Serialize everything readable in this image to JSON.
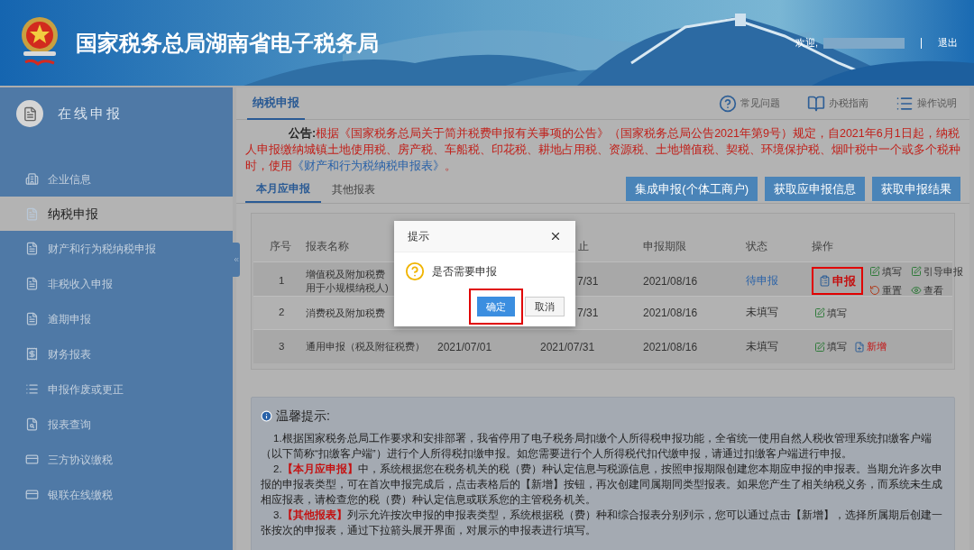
{
  "header": {
    "title": "国家税务总局湖南省电子税务局",
    "welcome": "欢迎,",
    "logout": "退出"
  },
  "sidebar": {
    "title": "在线申报",
    "items": [
      {
        "label": "企业信息",
        "selected": false
      },
      {
        "label": "纳税申报",
        "selected": true
      },
      {
        "label": "财产和行为税纳税申报",
        "selected": false
      },
      {
        "label": "非税收入申报",
        "selected": false
      },
      {
        "label": "逾期申报",
        "selected": false
      },
      {
        "label": "财务报表",
        "selected": false
      },
      {
        "label": "申报作废或更正",
        "selected": false
      },
      {
        "label": "报表查询",
        "selected": false
      },
      {
        "label": "三方协议缴税",
        "selected": false
      },
      {
        "label": "银联在线缴税",
        "selected": false
      }
    ]
  },
  "page_tabs": [
    {
      "label": "纳税申报",
      "selected": true
    }
  ],
  "help_links": [
    "常见问题",
    "办税指南",
    "操作说明"
  ],
  "notice": {
    "label": "公告:",
    "text": "根据《国家税务总局关于简并税费申报有关事项的公告》（国家税务总局公告2021年第9号）规定，自2021年6月1日起，纳税人申报缴纳城镇土地使用税、房产税、车船税、印花税、耕地占用税、资源税、土地增值税、契税、环境保护税、烟叶税中一个或多个税种时，使用",
    "link": "《财产和行为税纳税申报表》",
    "end": "。"
  },
  "sub_tabs": [
    {
      "label": "本月应申报",
      "selected": true
    },
    {
      "label": "其他报表",
      "selected": false
    }
  ],
  "toolbar_buttons": [
    "集成申报(个体工商户)",
    "获取应申报信息",
    "获取申报结果"
  ],
  "table": {
    "columns": [
      "序号",
      "报表名称",
      "止",
      "申报期限",
      "状态",
      "操作"
    ],
    "rows": [
      {
        "no": "1",
        "name": [
          "增值税及附加税费",
          "用于小规模纳税人)"
        ],
        "end": "7/31",
        "deadline": "2021/08/16",
        "status": "待申报",
        "color": "#2a62a8",
        "actions": [
          {
            "label": "申报",
            "kind": "declare",
            "highlighted": true
          },
          {
            "label": "填写",
            "kind": "edit",
            "highlighted": false
          },
          {
            "label": "引导申报",
            "kind": "edit",
            "highlighted": false
          },
          {
            "label": "重置",
            "kind": "reset",
            "highlighted": false
          },
          {
            "label": "查看",
            "kind": "view",
            "highlighted": false
          }
        ]
      },
      {
        "no": "2",
        "name": [
          "消费税及附加税费"
        ],
        "end": "7/31",
        "deadline": "2021/08/16",
        "status": "未填写",
        "color": "#333333",
        "actions": [
          {
            "label": "填写",
            "kind": "edit",
            "highlighted": false
          }
        ]
      },
      {
        "no": "3",
        "name": [
          "通用申报（税及附征税费）"
        ],
        "start": "2021/07/01",
        "end": "2021/07/31",
        "deadline": "2021/08/16",
        "status": "未填写",
        "color": "#333333",
        "actions": [
          {
            "label": "填写",
            "kind": "edit",
            "highlighted": false
          },
          {
            "label": "新增",
            "kind": "add",
            "highlighted": false
          }
        ]
      }
    ]
  },
  "tips": {
    "title": "温馨提示:",
    "paragraphs": [
      "1.根据国家税务总局工作要求和安排部署，我省停用了电子税务局扣缴个人所得税申报功能，全省统一使用自然人税收管理系统扣缴客户端（以下简称“扣缴客户端”）进行个人所得税扣缴申报。如您需要进行个人所得税代扣代缴申报，请通过扣缴客户端进行申报。",
      "2.**【本月应申报】**中，系统根据您在税务机关的税（费）种认定信息与税源信息，按照申报期限创建您本期应申报的申报表。当期允许多次申报的申报表类型，可在首次申报完成后，点击表格后的【新增】按钮，再次创建同属期同类型报表。如果您产生了相关纳税义务，而系统未生成相应报表，请检查您的税（费）种认定信息或联系您的主管税务机关。",
      "3.**【其他报表】**列示允许按次申报的申报表类型，系统根据税（费）种和综合报表分别列示，您可以通过点击【新增】，选择所属期后创建一张按次的申报表，通过下拉箭头展开界面，对展示的申报表进行填写。"
    ]
  },
  "dialog": {
    "title": "提示",
    "message": "是否需要申报",
    "buttons": [
      {
        "label": "确定",
        "kind": "primary",
        "highlighted": true
      },
      {
        "label": "取消",
        "kind": "secondary",
        "highlighted": false
      }
    ]
  }
}
